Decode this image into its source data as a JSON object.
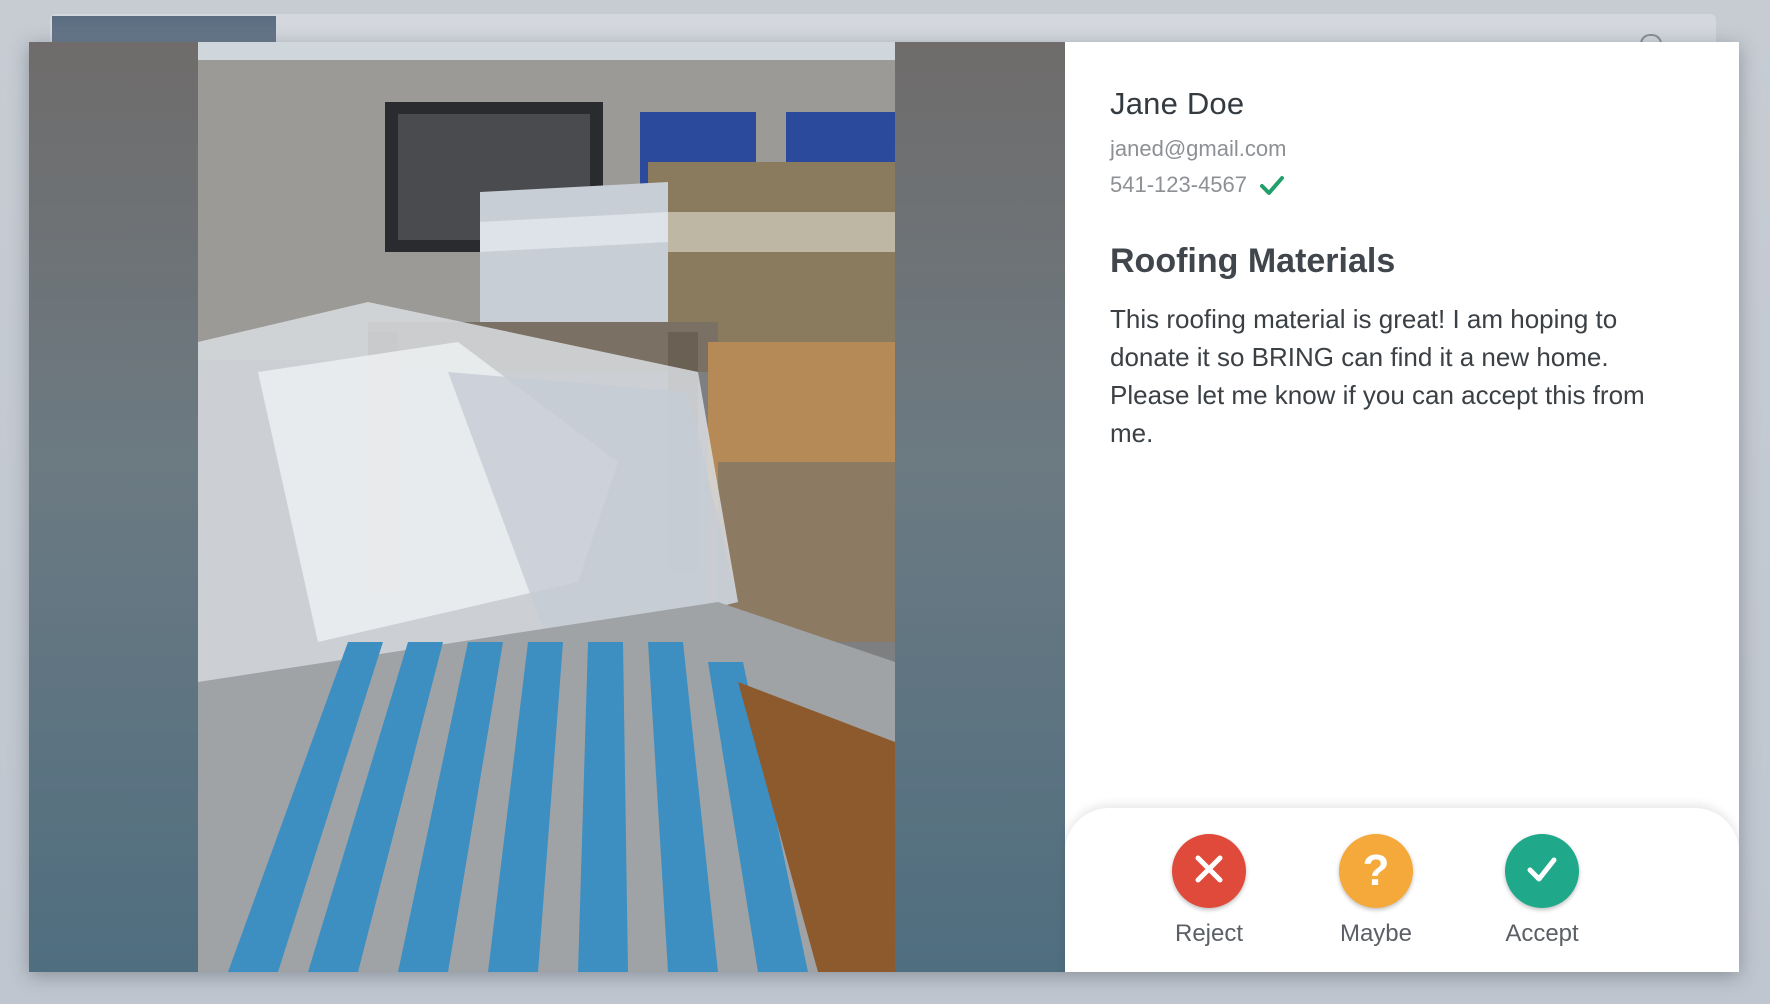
{
  "donor": {
    "name": "Jane Doe",
    "email": "janed@gmail.com",
    "phone": "541-123-4567",
    "phone_verified": true
  },
  "item": {
    "title": "Roofing Materials",
    "description": "This roofing material is great! I am hoping to donate it so BRING can find it a new home. Please let me know if you can accept this from me."
  },
  "actions": {
    "reject": {
      "label": "Reject",
      "color": "#e04a3a",
      "icon": "close-icon"
    },
    "maybe": {
      "label": "Maybe",
      "color": "#f5a93a",
      "icon": "question-mark-icon"
    },
    "accept": {
      "label": "Accept",
      "color": "#1fa88a",
      "icon": "checkmark-icon"
    }
  },
  "colors": {
    "verified": "#22a06b"
  }
}
